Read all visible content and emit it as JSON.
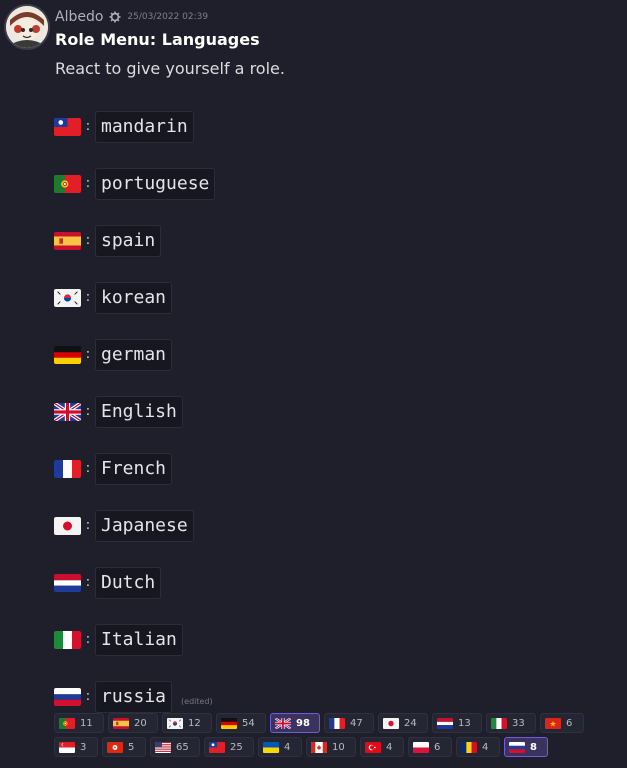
{
  "message": {
    "author": "Albedo",
    "bot_icon": "gear-icon",
    "timestamp": "25/03/2022 02:39",
    "title": "Role Menu: Languages",
    "description": "React to give yourself a role.",
    "colon": ":",
    "edited_label": "(edited)"
  },
  "roles": [
    {
      "flag": "taiwan",
      "name": "mandarin"
    },
    {
      "flag": "portugal",
      "name": "portuguese"
    },
    {
      "flag": "spain",
      "name": "spain"
    },
    {
      "flag": "korea",
      "name": "korean"
    },
    {
      "flag": "germany",
      "name": "german"
    },
    {
      "flag": "uk",
      "name": "English"
    },
    {
      "flag": "france",
      "name": "French"
    },
    {
      "flag": "japan",
      "name": "Japanese"
    },
    {
      "flag": "netherlands",
      "name": "Dutch"
    },
    {
      "flag": "italy",
      "name": "Italian"
    },
    {
      "flag": "russia",
      "name": "russia"
    }
  ],
  "reactions": [
    {
      "flag": "portugal",
      "count": "11",
      "active": false
    },
    {
      "flag": "spain",
      "count": "20",
      "active": false
    },
    {
      "flag": "korea",
      "count": "12",
      "active": false
    },
    {
      "flag": "germany",
      "count": "54",
      "active": false
    },
    {
      "flag": "uk",
      "count": "98",
      "active": true
    },
    {
      "flag": "france",
      "count": "47",
      "active": false
    },
    {
      "flag": "japan",
      "count": "24",
      "active": false
    },
    {
      "flag": "netherlands",
      "count": "13",
      "active": false
    },
    {
      "flag": "italy",
      "count": "33",
      "active": false
    },
    {
      "flag": "vietnam",
      "count": "6",
      "active": false
    },
    {
      "flag": "singapore",
      "count": "3",
      "active": false
    },
    {
      "flag": "hongkong",
      "count": "5",
      "active": false
    },
    {
      "flag": "usa",
      "count": "65",
      "active": false
    },
    {
      "flag": "taiwan",
      "count": "25",
      "active": false
    },
    {
      "flag": "ukraine",
      "count": "4",
      "active": false
    },
    {
      "flag": "canada",
      "count": "10",
      "active": false
    },
    {
      "flag": "turkey",
      "count": "4",
      "active": false
    },
    {
      "flag": "poland",
      "count": "6",
      "active": false
    },
    {
      "flag": "romania",
      "count": "4",
      "active": false
    },
    {
      "flag": "russia",
      "count": "8",
      "active": true
    }
  ]
}
